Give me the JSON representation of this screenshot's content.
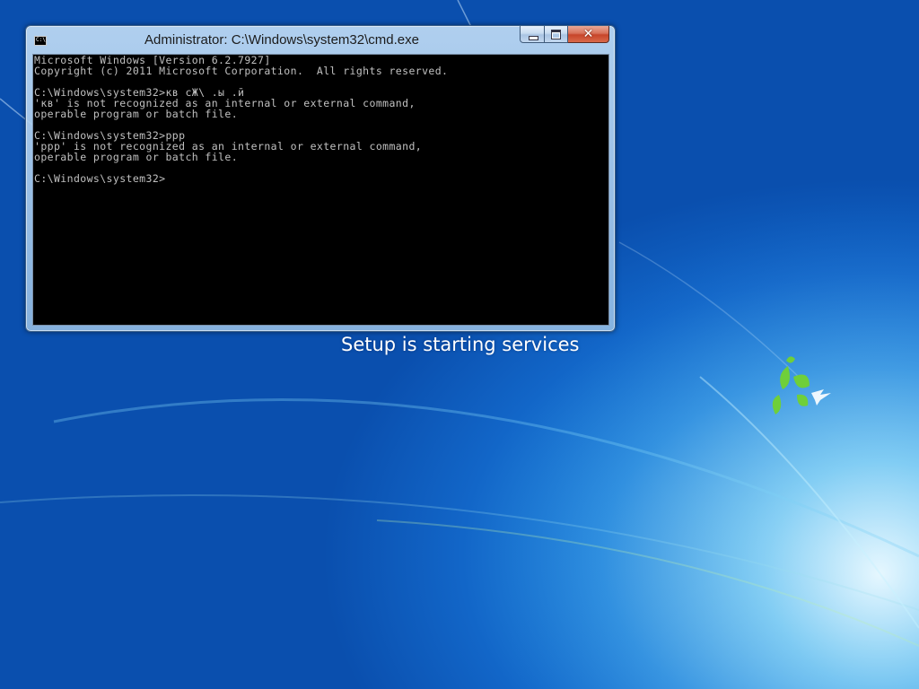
{
  "window": {
    "title": "Administrator: C:\\Windows\\system32\\cmd.exe",
    "app_icon": "cmd-icon",
    "app_icon_text": "C:\\",
    "buttons": {
      "minimize_icon": "minimize-icon",
      "maximize_icon": "maximize-icon",
      "close_icon": "close-icon",
      "close_glyph": "✕"
    }
  },
  "console": {
    "lines": [
      "Microsoft Windows [Version 6.2.7927]",
      "Copyright (c) 2011 Microsoft Corporation.  All rights reserved.",
      "",
      "C:\\Windows\\system32>кв сЖ\\ .ы .й",
      "'кв' is not recognized as an internal or external command,",
      "operable program or batch file.",
      "",
      "C:\\Windows\\system32>ppp",
      "'ppp' is not recognized as an internal or external command,",
      "operable program or batch file.",
      "",
      "C:\\Windows\\system32>"
    ]
  },
  "status": {
    "text": "Setup is starting services"
  },
  "colors": {
    "console_background": "#000000",
    "console_text": "#c0c0c0",
    "desktop_blue": "#1460c2",
    "close_button": "#c7452a"
  }
}
